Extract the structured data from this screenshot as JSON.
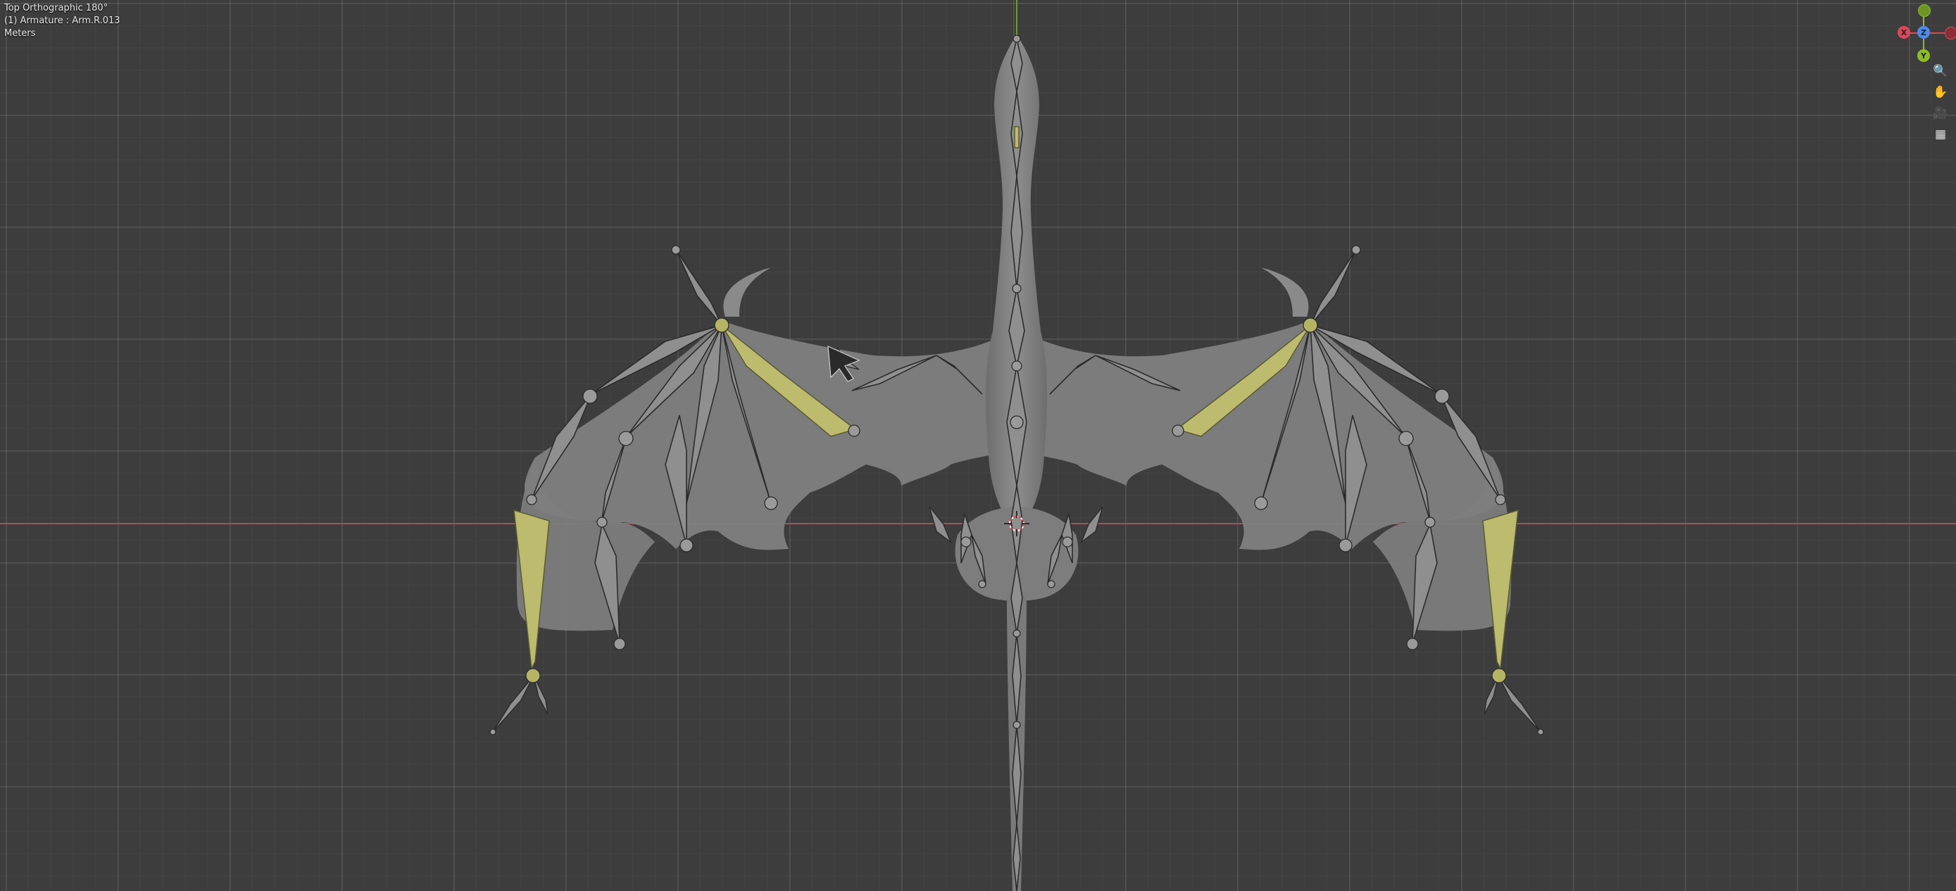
{
  "viewport": {
    "view_name": "Top Orthographic 180°",
    "object_info": "(1) Armature : Arm.R.013",
    "units": "Meters"
  },
  "gizmo": {
    "z_label": "Z",
    "x_neg_label": "X",
    "y_neg_label": "Y",
    "colors": {
      "x": "#e0465a",
      "y": "#8dbb2a",
      "z": "#4a8cf0"
    }
  },
  "navigation": {
    "buttons": [
      "zoom-icon",
      "hand-pan-icon",
      "camera-icon",
      "grid-ortho-icon"
    ],
    "zoom_glyph": "🔍",
    "pan_glyph": "✋",
    "camera_glyph": "🎥",
    "grid_glyph": "▦"
  },
  "scene": {
    "selected_bone_color": "#bcbb6e",
    "bone_color": "#8f8f8f",
    "mesh_color": "#8a8a8a"
  }
}
